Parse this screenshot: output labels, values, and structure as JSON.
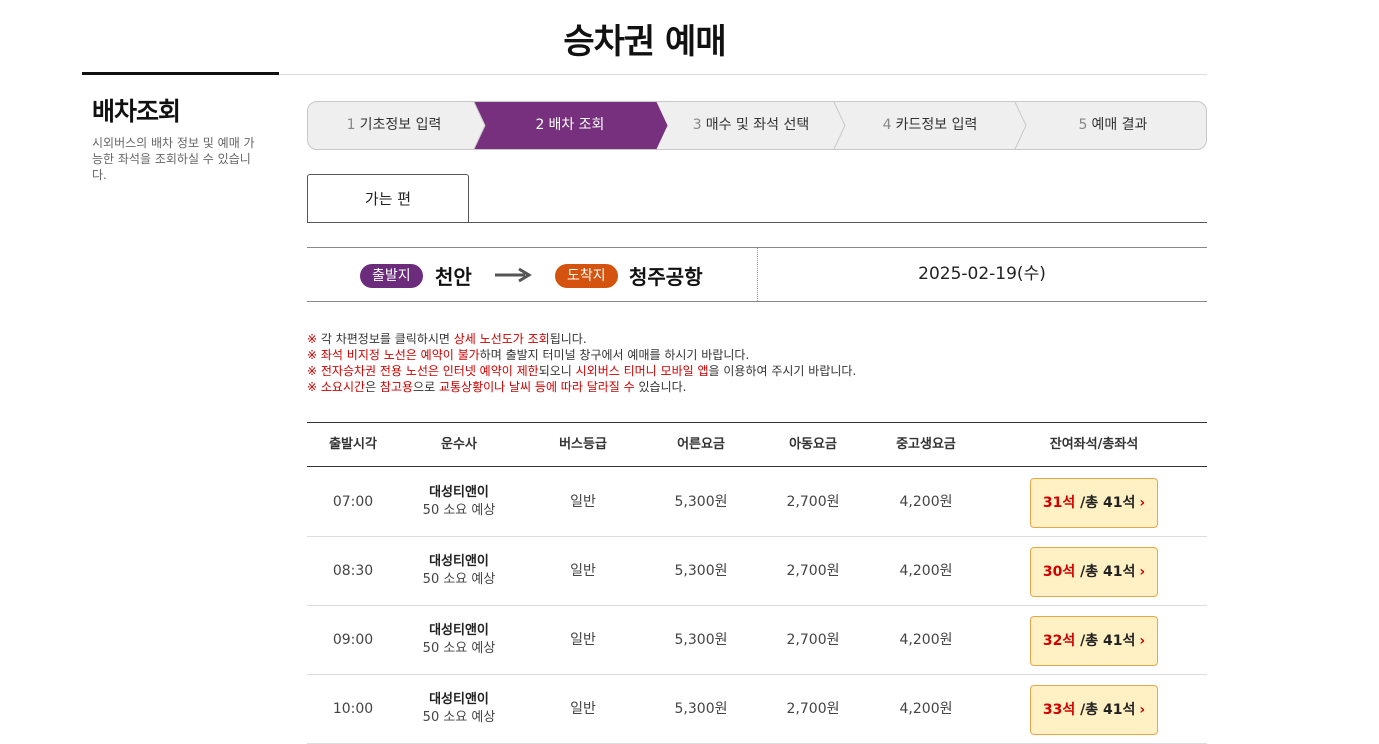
{
  "page_title": "승차권 예매",
  "sidebar": {
    "title": "배차조회",
    "description": "시외버스의 배차 정보 및 예매 가능한 좌석을 조회하실 수 있습니다."
  },
  "steps": [
    {
      "num": "1",
      "label": "기초정보 입력",
      "active": false
    },
    {
      "num": "2",
      "label": "배차 조회",
      "active": true
    },
    {
      "num": "3",
      "label": "매수 및 좌석 선택",
      "active": false
    },
    {
      "num": "4",
      "label": "카드정보 입력",
      "active": false
    },
    {
      "num": "5",
      "label": "예매 결과",
      "active": false
    }
  ],
  "tab": {
    "label": "가는 편"
  },
  "route": {
    "departure_badge": "출발지",
    "departure": "천안",
    "arrival_badge": "도착지",
    "arrival": "청주공항",
    "date": "2025-02-19(수)"
  },
  "notices": [
    {
      "mark": "※",
      "parts": [
        {
          "t": " 각 차편정보를 클릭하시면 ",
          "hl": false
        },
        {
          "t": "상세 노선도가 조회",
          "hl": true
        },
        {
          "t": "됩니다.",
          "hl": false
        }
      ]
    },
    {
      "mark": "※",
      "parts": [
        {
          "t": " ",
          "hl": false
        },
        {
          "t": "좌석 비지정 노선은 예약이 불가",
          "hl": true
        },
        {
          "t": "하며 출발지 터미널 창구에서 예매를 하시기 바랍니다.",
          "hl": false
        }
      ]
    },
    {
      "mark": "※",
      "parts": [
        {
          "t": " ",
          "hl": false
        },
        {
          "t": "전자승차권 전용 노선은 인터넷 예약이 제한",
          "hl": true
        },
        {
          "t": "되오니 ",
          "hl": false
        },
        {
          "t": "시외버스 티머니 모바일 앱",
          "hl": true
        },
        {
          "t": "을 이용하여 주시기 바랍니다.",
          "hl": false
        }
      ]
    },
    {
      "mark": "※",
      "parts": [
        {
          "t": " ",
          "hl": false
        },
        {
          "t": "소요시간",
          "hl": true
        },
        {
          "t": "은 ",
          "hl": false
        },
        {
          "t": "참고용",
          "hl": true
        },
        {
          "t": "으로 ",
          "hl": false
        },
        {
          "t": "교통상황이나 날씨 등에 따라 달라질 수",
          "hl": true
        },
        {
          "t": " 있습니다.",
          "hl": false
        }
      ]
    }
  ],
  "table": {
    "headers": {
      "time": "출발시각",
      "company": "운수사",
      "grade": "버스등급",
      "adult": "어른요금",
      "child": "아동요금",
      "teen": "중고생요금",
      "seats": "잔여좌석/총좌석"
    },
    "rows": [
      {
        "time": "07:00",
        "company": "대성티앤이",
        "duration": "50 소요 예상",
        "grade": "일반",
        "adult": "5,300원",
        "child": "2,700원",
        "teen": "4,200원",
        "remaining": "31석",
        "total": " /총 41석"
      },
      {
        "time": "08:30",
        "company": "대성티앤이",
        "duration": "50 소요 예상",
        "grade": "일반",
        "adult": "5,300원",
        "child": "2,700원",
        "teen": "4,200원",
        "remaining": "30석",
        "total": " /총 41석"
      },
      {
        "time": "09:00",
        "company": "대성티앤이",
        "duration": "50 소요 예상",
        "grade": "일반",
        "adult": "5,300원",
        "child": "2,700원",
        "teen": "4,200원",
        "remaining": "32석",
        "total": " /총 41석"
      },
      {
        "time": "10:00",
        "company": "대성티앤이",
        "duration": "50 소요 예상",
        "grade": "일반",
        "adult": "5,300원",
        "child": "2,700원",
        "teen": "4,200원",
        "remaining": "33석",
        "total": " /총 41석"
      }
    ]
  },
  "colors": {
    "step_active": "#77307e",
    "departure_badge": "#6b2d7b",
    "arrival_badge": "#d4530f",
    "highlight_red": "#d00000",
    "seat_button_bg": "#fff1c4",
    "seat_button_border": "#e8a64b"
  }
}
